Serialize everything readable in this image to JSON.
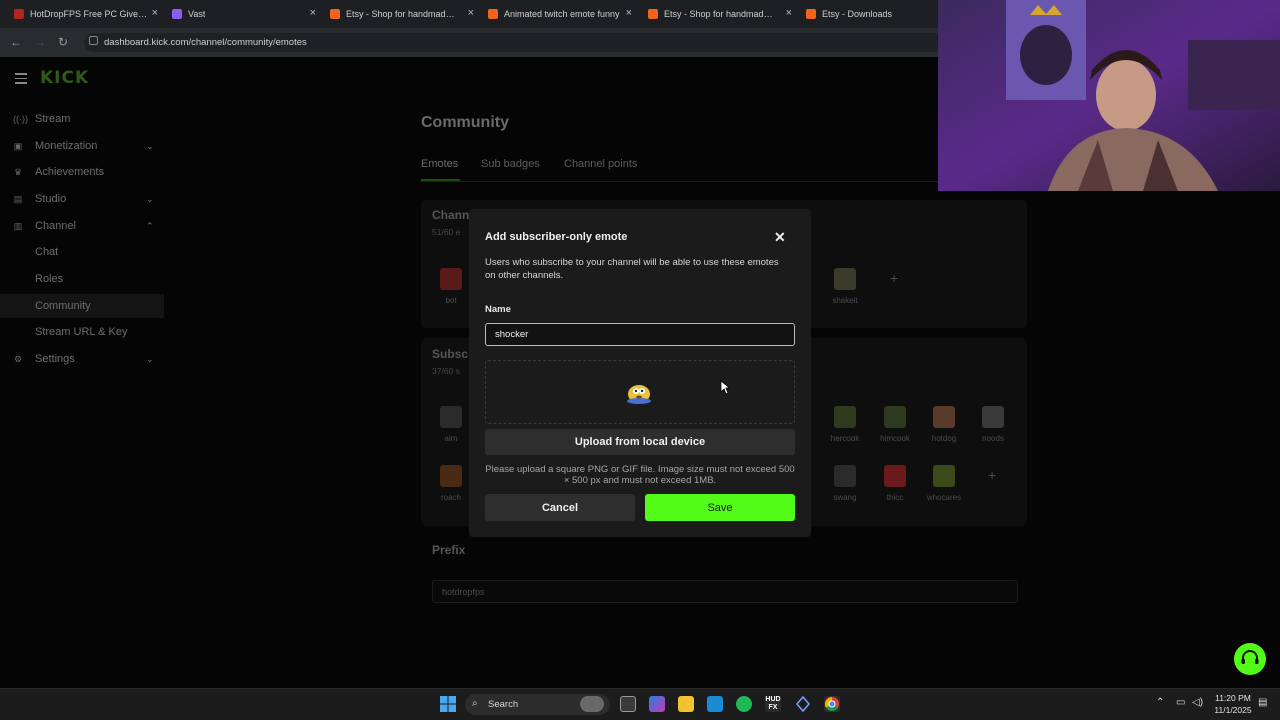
{
  "browser": {
    "tabs": [
      {
        "title": "HotDropFPS Free PC Giveaway",
        "icon": "hotdrop-favicon-icon",
        "color": "#b3261e"
      },
      {
        "title": "Vast",
        "icon": "vast-favicon-icon",
        "color": "#8b5cf6"
      },
      {
        "title": "Etsy - Shop for handmade, vintage",
        "icon": "etsy-favicon-icon",
        "color": "#f1641e"
      },
      {
        "title": "Animated twitch emote funny",
        "icon": "etsy-favicon-icon",
        "color": "#f1641e"
      },
      {
        "title": "Etsy - Shop for handmade, vintage",
        "icon": "etsy-favicon-icon",
        "color": "#f1641e"
      },
      {
        "title": "Etsy - Downloads",
        "icon": "etsy-favicon-icon",
        "color": "#f1641e"
      }
    ],
    "url": "dashboard.kick.com/channel/community/emotes"
  },
  "sidebar": {
    "items": [
      {
        "label": "Stream",
        "icon": "stream-icon",
        "chevron": ""
      },
      {
        "label": "Monetization",
        "icon": "monetization-icon",
        "chevron": "⌄"
      },
      {
        "label": "Achievements",
        "icon": "trophy-icon",
        "chevron": ""
      },
      {
        "label": "Studio",
        "icon": "studio-icon",
        "chevron": "⌄"
      },
      {
        "label": "Channel",
        "icon": "channel-icon",
        "chevron": "⌃"
      },
      {
        "label": "Chat",
        "icon": "",
        "chevron": ""
      },
      {
        "label": "Roles",
        "icon": "",
        "chevron": ""
      },
      {
        "label": "Community",
        "icon": "",
        "chevron": ""
      },
      {
        "label": "Stream URL & Key",
        "icon": "",
        "chevron": ""
      },
      {
        "label": "Settings",
        "icon": "settings-icon",
        "chevron": "⌄"
      }
    ],
    "active_index": 7
  },
  "page": {
    "title": "Community",
    "tabs": [
      "Emotes",
      "Sub badges",
      "Channel points"
    ],
    "active_tab": 0
  },
  "channel_emotes": {
    "title": "Chann",
    "count": "51/60 e",
    "emotes": [
      {
        "name": "bot",
        "color": "#5a1a1a"
      },
      {
        "name": "shakeit",
        "color": "#3a3a2a"
      }
    ]
  },
  "sub_emotes": {
    "title": "Subsc",
    "count": "37/60 s",
    "emotes": [
      {
        "name": "aim",
        "color": "#2a2a2a"
      },
      {
        "name": "roach",
        "color": "#4a2a12"
      },
      {
        "name": "hercook",
        "color": "#2e3a1e"
      },
      {
        "name": "himcook",
        "color": "#2e3a1e"
      },
      {
        "name": "hotdog",
        "color": "#5a3a28"
      },
      {
        "name": "noods",
        "color": "#3a3a3a"
      },
      {
        "name": "swang",
        "color": "#2a2a2a"
      },
      {
        "name": "thicc",
        "color": "#6a1a1a"
      },
      {
        "name": "whocares",
        "color": "#3c4a1a"
      }
    ]
  },
  "prefix": {
    "label": "Prefix",
    "value": "hotdropfps"
  },
  "modal": {
    "title": "Add subscriber-only emote",
    "description": "Users who subscribe to your channel will be able to use these emotes on other channels.",
    "name_label": "Name",
    "name_value": "shocker",
    "upload_label": "Upload from local device",
    "help_text": "Please upload a square PNG or GIF file. Image size must not exceed 500 × 500 px and must not exceed 1MB.",
    "cancel_label": "Cancel",
    "save_label": "Save"
  },
  "taskbar": {
    "search_label": "Search",
    "time": "11:20 PM",
    "date": "11/1/2025"
  },
  "colors": {
    "kick_green": "#53fc18",
    "modal_bg": "#1b1b1c",
    "page_bg": "#050505"
  }
}
